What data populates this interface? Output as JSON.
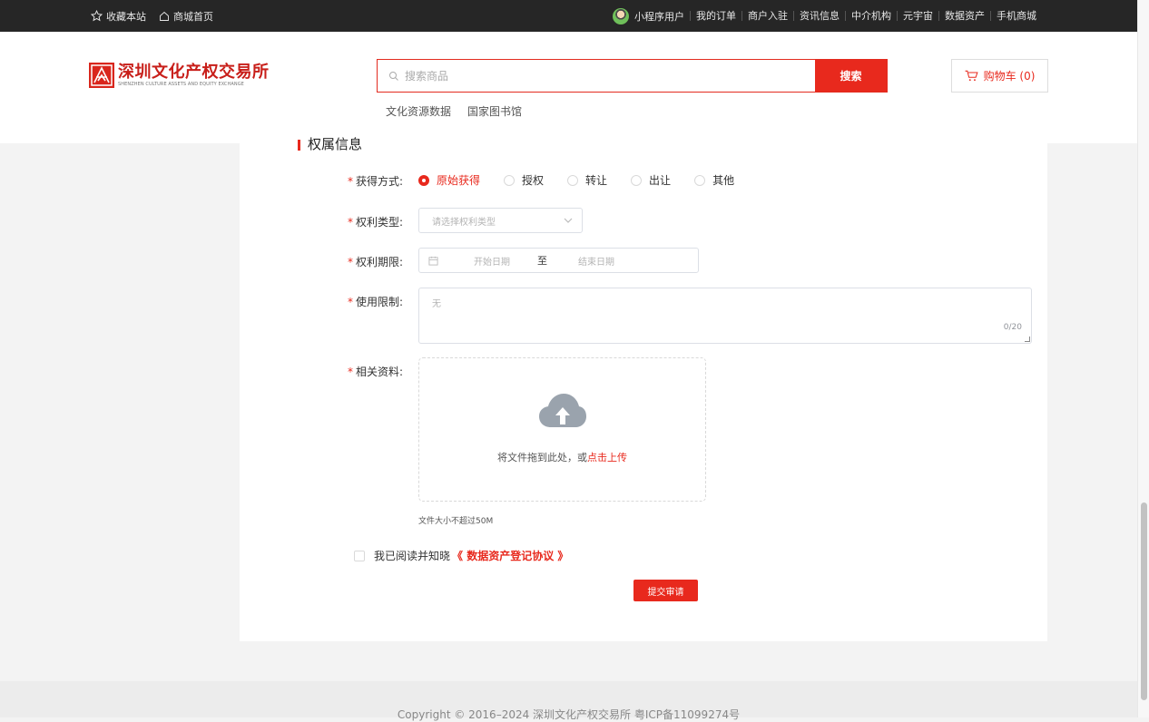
{
  "topbar": {
    "favorite": "收藏本站",
    "mall_home": "商城首页",
    "user": "小程序用户",
    "links": [
      "我的订单",
      "商户入驻",
      "资讯信息",
      "中介机构",
      "元宇宙",
      "数据资产",
      "手机商城"
    ]
  },
  "logo": {
    "cn": "深圳文化产权交易所",
    "en": "SHENZHEN CULTURE ASSETS AND EQUITY EXCHANGE"
  },
  "search": {
    "placeholder": "搜索商品",
    "button": "搜索"
  },
  "hot_links": [
    "文化资源数据",
    "国家图书馆"
  ],
  "cart": {
    "label": "购物车 (0)"
  },
  "section": {
    "title": "权属信息"
  },
  "form": {
    "acquire": {
      "label": "获得方式:",
      "options": [
        "原始获得",
        "授权",
        "转让",
        "出让",
        "其他"
      ],
      "selected": "原始获得"
    },
    "right_type": {
      "label": "权利类型:",
      "placeholder": "请选择权利类型"
    },
    "right_term": {
      "label": "权利期限:",
      "start_placeholder": "开始日期",
      "separator": "至",
      "end_placeholder": "结束日期"
    },
    "usage_limit": {
      "label": "使用限制:",
      "placeholder": "无",
      "count": "0/20"
    },
    "materials": {
      "label": "相关资料:",
      "tip_prefix": "将文件拖到此处，或",
      "tip_link": "点击上传",
      "hint": "文件大小不超过50M"
    },
    "agreement": {
      "text": "我已阅读并知晓",
      "link": "《 数据资产登记协议 》"
    },
    "submit": "提交审请"
  },
  "footer": {
    "copyright": "Copyright © 2016–2024 深圳文化产权交易所 粤ICP备11099274号"
  },
  "colors": {
    "accent": "#e8291d",
    "topbar": "#262626"
  }
}
